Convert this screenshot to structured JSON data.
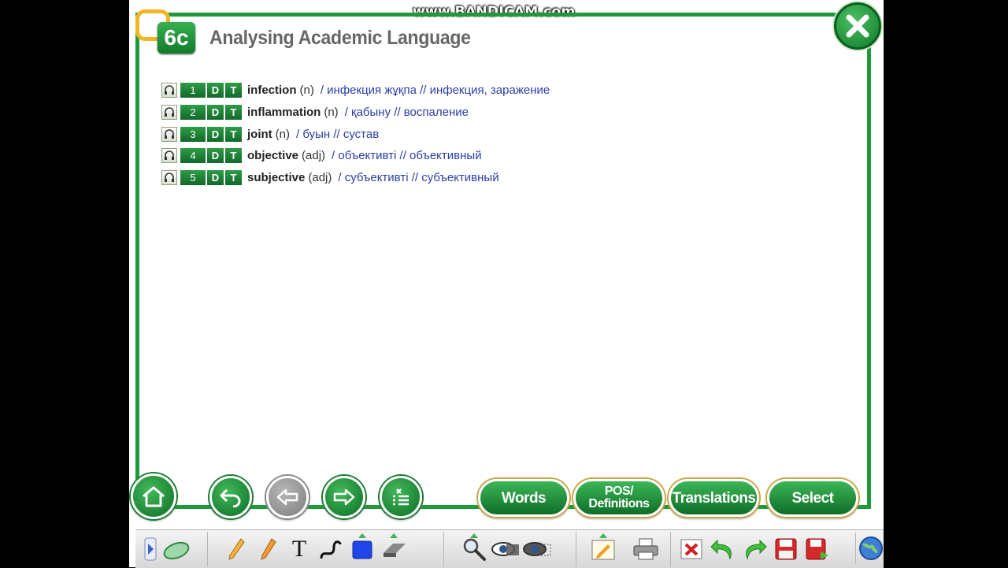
{
  "watermark": "www.BANDICAM.com",
  "unit": {
    "badge": "6c",
    "title": "Analysing Academic Language"
  },
  "vocab": [
    {
      "num": "1",
      "d": "D",
      "t": "T",
      "word": "infection",
      "pos": "(n)",
      "translation": "/ инфекция жұқпа // инфекция, заражение"
    },
    {
      "num": "2",
      "d": "D",
      "t": "T",
      "word": "inflammation",
      "pos": "(n)",
      "translation": "/ қабыну // воспаление"
    },
    {
      "num": "3",
      "d": "D",
      "t": "T",
      "word": "joint",
      "pos": "(n)",
      "translation": "/ буын // сустав"
    },
    {
      "num": "4",
      "d": "D",
      "t": "T",
      "word": "objective",
      "pos": "(adj)",
      "translation": "/ объективті // объективный"
    },
    {
      "num": "5",
      "d": "D",
      "t": "T",
      "word": "subjective",
      "pos": "(adj)",
      "translation": "/ субъективті // субъективный"
    }
  ],
  "bottom_buttons": {
    "words": "Words",
    "pos_line1": "POS/",
    "pos_line2": "Definitions",
    "translations": "Translations",
    "select": "Select"
  },
  "toolbar": {
    "text_tool": "T"
  },
  "colors": {
    "frame": "#1e9a3a",
    "accent_gold": "#f0b628",
    "translation_text": "#2b3ea6"
  }
}
